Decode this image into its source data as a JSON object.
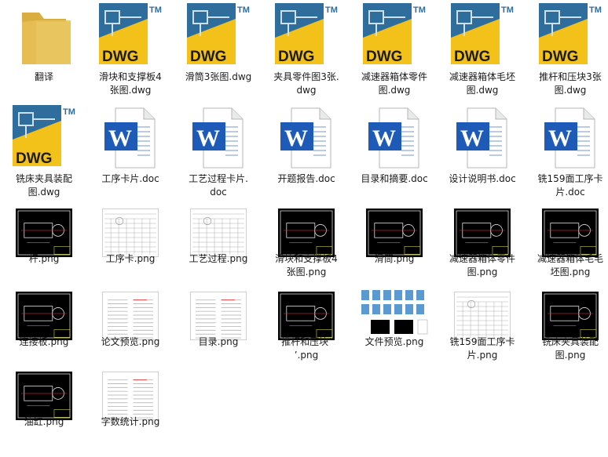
{
  "files": [
    {
      "name": "翻译",
      "type": "folder"
    },
    {
      "name": "滑块和支撑板4\n张图.dwg",
      "type": "dwg"
    },
    {
      "name": "滑筒3张图.dwg",
      "type": "dwg"
    },
    {
      "name": "夹具零件图3张.\ndwg",
      "type": "dwg"
    },
    {
      "name": "减速器箱体零件\n图.dwg",
      "type": "dwg"
    },
    {
      "name": "减速器箱体毛坯\n图.dwg",
      "type": "dwg"
    },
    {
      "name": "推杆和压块3张\n图.dwg",
      "type": "dwg"
    },
    {
      "name": "铣床夹具装配\n图.dwg",
      "type": "dwg"
    },
    {
      "name": "工序卡片.doc",
      "type": "doc"
    },
    {
      "name": "工艺过程卡片.\ndoc",
      "type": "doc"
    },
    {
      "name": "开题报告.doc",
      "type": "doc"
    },
    {
      "name": "目录和摘要.doc",
      "type": "doc"
    },
    {
      "name": "设计说明书.doc",
      "type": "doc"
    },
    {
      "name": "铣159面工序卡\n片.doc",
      "type": "doc"
    },
    {
      "name": "杆.png",
      "type": "png-cad"
    },
    {
      "name": "工序卡.png",
      "type": "png-table"
    },
    {
      "name": "工艺过程.png",
      "type": "png-table"
    },
    {
      "name": "滑块和支撑板4\n张图.png",
      "type": "png-cad"
    },
    {
      "name": "滑筒.png",
      "type": "png-cad"
    },
    {
      "name": "减速器箱体零件\n图.png",
      "type": "png-cad"
    },
    {
      "name": "减速器箱体毛毛\n坯图.png",
      "type": "png-cad"
    },
    {
      "name": "连接板.png",
      "type": "png-cad"
    },
    {
      "name": "论文预览.png",
      "type": "png-doc"
    },
    {
      "name": "目录.png",
      "type": "png-doc"
    },
    {
      "name": "推杆和压块‘\n’.png",
      "type": "png-cad"
    },
    {
      "name": "文件预览.png",
      "type": "png-preview"
    },
    {
      "name": "铣159面工序卡\n片.png",
      "type": "png-table"
    },
    {
      "name": "铣床夹具装配\n图.png",
      "type": "png-cad"
    },
    {
      "name": "油缸.png",
      "type": "png-cad"
    },
    {
      "name": "字数统计.png",
      "type": "png-doc"
    }
  ],
  "icons": {
    "dwg_text": "DWG",
    "tm_text": "TM",
    "word_letter": "W"
  },
  "colors": {
    "folder": "#e8c35a",
    "dwg_blue": "#2f6d9c",
    "dwg_yellow": "#f2c21b",
    "word_blue": "#1e5bb8",
    "cad_line": "#d8d8d8"
  }
}
